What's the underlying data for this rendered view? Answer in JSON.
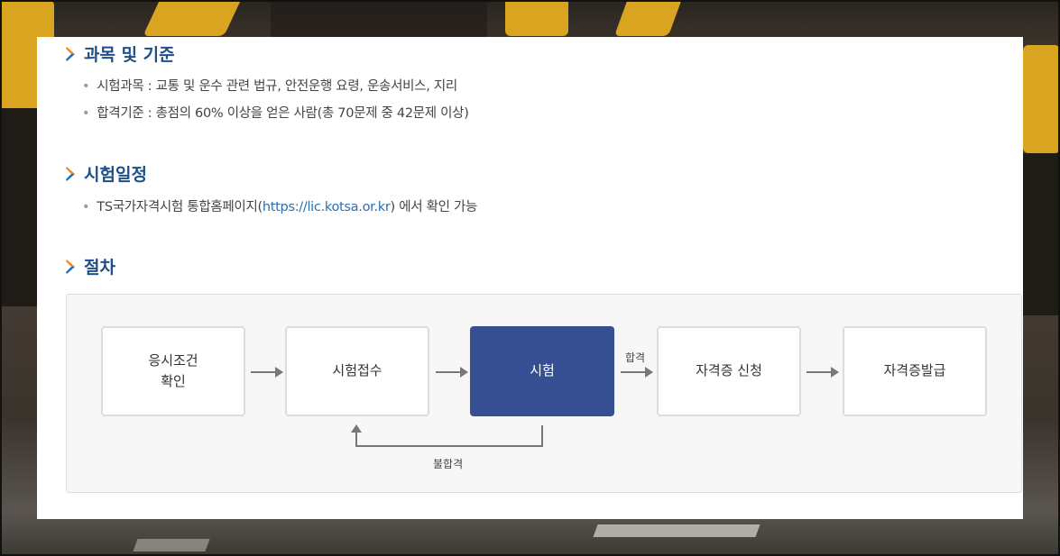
{
  "sections": {
    "subjects": {
      "title": "과목 및 기준",
      "items": [
        "시험과목 : 교통 및 운수 관련 법규, 안전운행 요령, 운송서비스, 지리",
        "합격기준 : 총점의 60% 이상을 얻은 사람(총 70문제 중 42문제 이상)"
      ]
    },
    "schedule": {
      "title": "시험일정",
      "prefix": "TS국가자격시험 통합홈페이지(",
      "link": "https://lic.kotsa.or.kr",
      "suffix": ") 에서 확인 가능"
    },
    "procedure": {
      "title": "절차",
      "steps": [
        "응시조건\n확인",
        "시험접수",
        "시험",
        "자격증 신청",
        "자격증발급"
      ],
      "pass_label": "합격",
      "fail_label": "불합격"
    }
  },
  "colors": {
    "title": "#1f4f8a",
    "chevron_top": "#f08a1c",
    "chevron_bottom": "#1f6fb8",
    "active_step": "#364f92",
    "link": "#2a6fb0"
  },
  "icons": {
    "section_marker": "chevron-right-icon",
    "flow_arrow": "arrow-right-icon"
  }
}
